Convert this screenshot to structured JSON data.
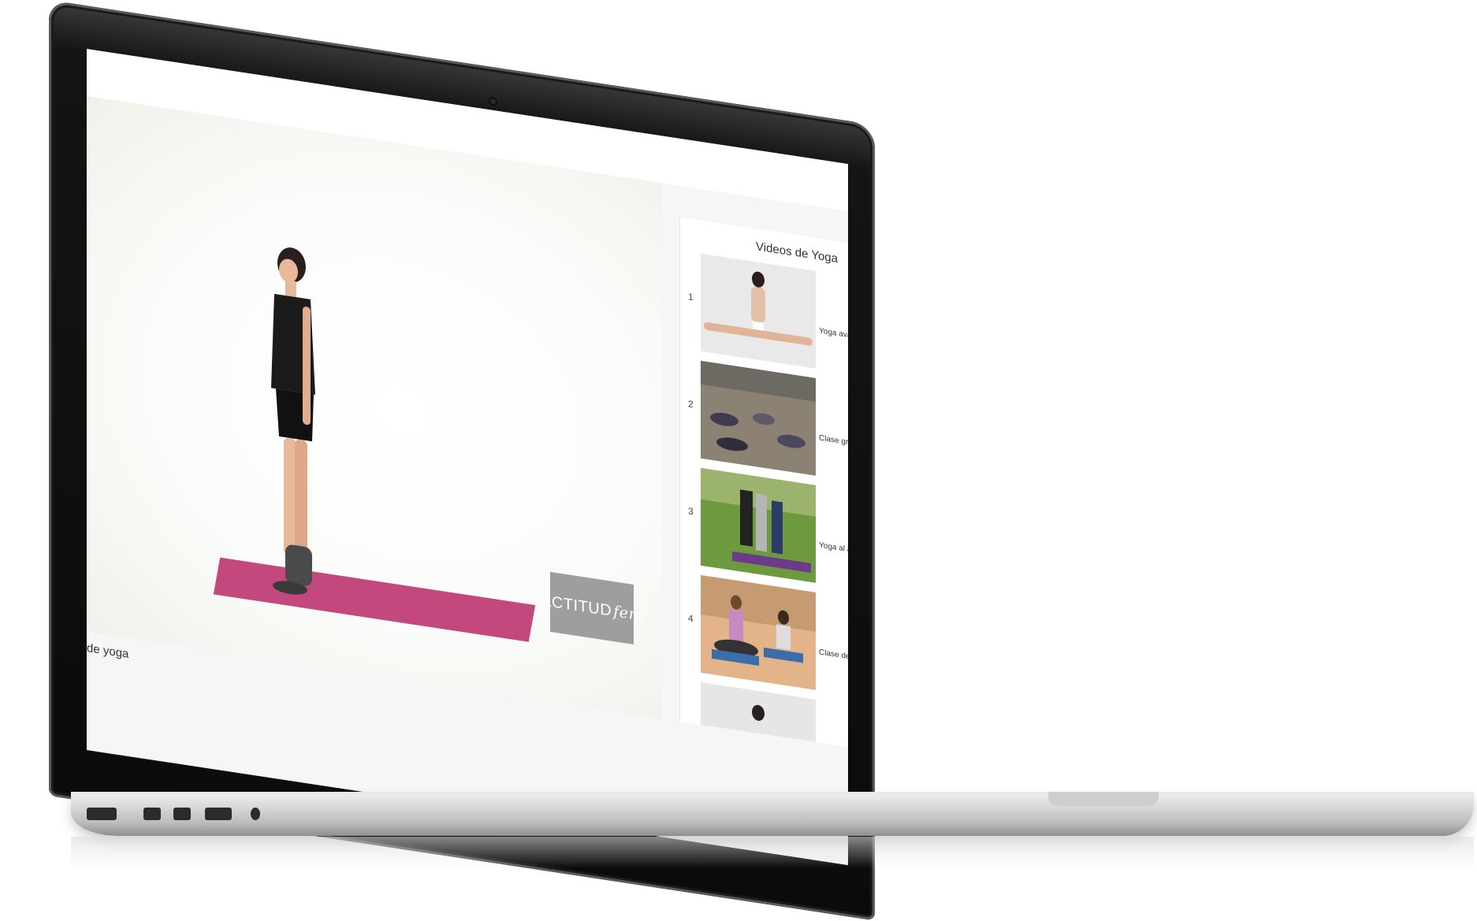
{
  "video": {
    "logo_main": "ACTITUD",
    "logo_script": "fem",
    "caption": "de yoga"
  },
  "playlist": {
    "title": "Videos de Yoga",
    "items": [
      {
        "num": "1",
        "title": "Yoga avanz"
      },
      {
        "num": "2",
        "title": "Clase graba"
      },
      {
        "num": "3",
        "title": "Yoga al aire"
      },
      {
        "num": "4",
        "title": "Clase de yo"
      }
    ]
  },
  "icons": [
    "webcam-icon",
    "usb-port-icon",
    "thunderbolt-port-icon",
    "hdmi-port-icon",
    "headphone-jack-icon"
  ],
  "colors": {
    "mat": "#c2487e",
    "logo_bg": "#9e9e9e",
    "screen_bg": "#f6f6f6"
  }
}
